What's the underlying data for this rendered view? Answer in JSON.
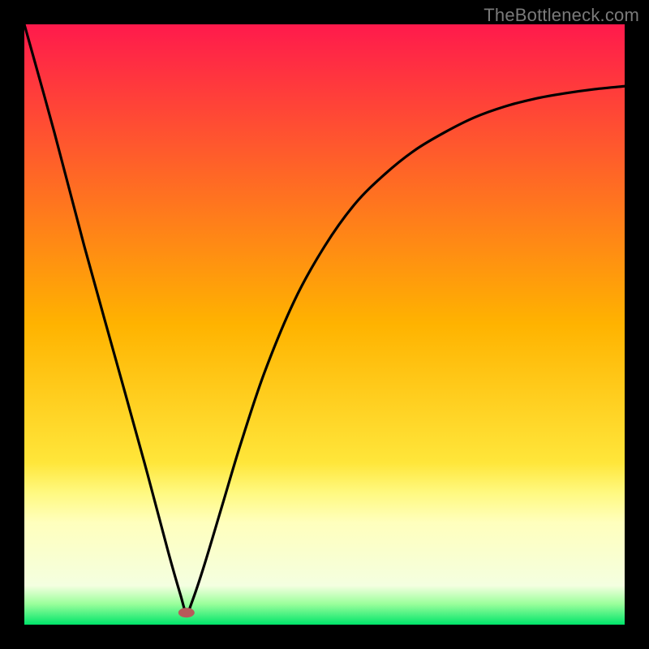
{
  "attribution": "TheBottleneck.com",
  "chart_data": {
    "type": "line",
    "title": "",
    "xlabel": "",
    "ylabel": "",
    "xlim": [
      0,
      100
    ],
    "ylim": [
      0,
      100
    ],
    "grid": false,
    "legend": false,
    "background_gradient": {
      "stops": [
        {
          "t": 0.0,
          "color": "#ff1a4c"
        },
        {
          "t": 0.5,
          "color": "#ffb300"
        },
        {
          "t": 0.73,
          "color": "#ffe63a"
        },
        {
          "t": 0.78,
          "color": "#fff980"
        },
        {
          "t": 0.83,
          "color": "#ffffbd"
        },
        {
          "t": 0.935,
          "color": "#f4ffe0"
        },
        {
          "t": 0.965,
          "color": "#9cff9c"
        },
        {
          "t": 1.0,
          "color": "#00e56a"
        }
      ]
    },
    "min_marker": {
      "x": 27,
      "y": 2,
      "color": "#b85a5a"
    },
    "series": [
      {
        "name": "bottleneck-curve",
        "x": [
          0,
          5,
          10,
          15,
          20,
          24,
          26,
          27,
          28,
          30,
          33,
          36,
          40,
          45,
          50,
          55,
          60,
          65,
          70,
          75,
          80,
          85,
          90,
          95,
          100
        ],
        "y": [
          100,
          82,
          63,
          45,
          27,
          12,
          5,
          2,
          4,
          10,
          20,
          30,
          42,
          54,
          63,
          70,
          75,
          79,
          82,
          84.5,
          86.3,
          87.6,
          88.5,
          89.2,
          89.7
        ]
      }
    ]
  }
}
